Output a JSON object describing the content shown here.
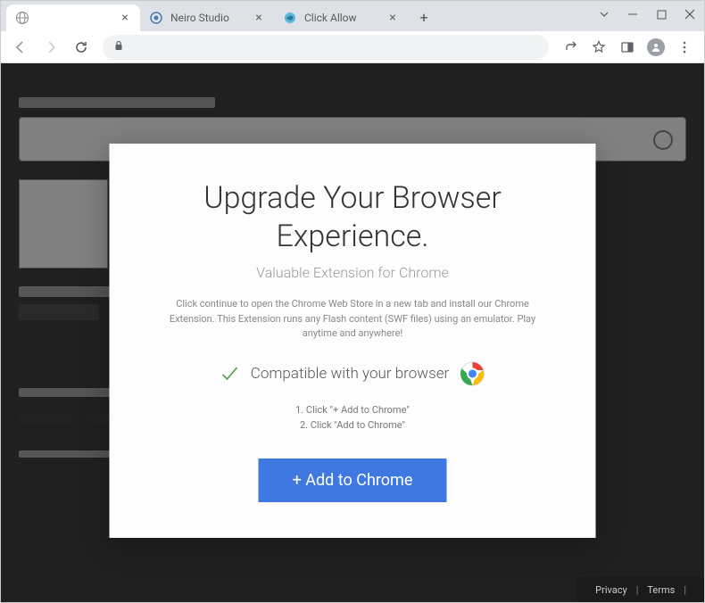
{
  "tabs": [
    {
      "title": "",
      "active": true
    },
    {
      "title": "Neiro Studio",
      "active": false
    },
    {
      "title": "Click Allow",
      "active": false
    }
  ],
  "dialog": {
    "heading": "Upgrade Your Browser Experience.",
    "subtitle": "Valuable Extension for Chrome",
    "body": "Click continue to open the Chrome Web Store in a new tab and install our Chrome Extension. This Extension runs any Flash content (SWF files) using an emulator. Play anytime and anywhere!",
    "compatible_text": "Compatible with your browser",
    "step1": "1. Click \"+ Add to Chrome\"",
    "step2": "2. Click \"Add to Chrome\"",
    "cta_label": "+ Add to Chrome"
  },
  "footer": {
    "privacy": "Privacy",
    "terms": "Terms"
  },
  "colors": {
    "cta_bg": "#3e78e0",
    "chrome_tab_bg": "#dee1e6"
  }
}
